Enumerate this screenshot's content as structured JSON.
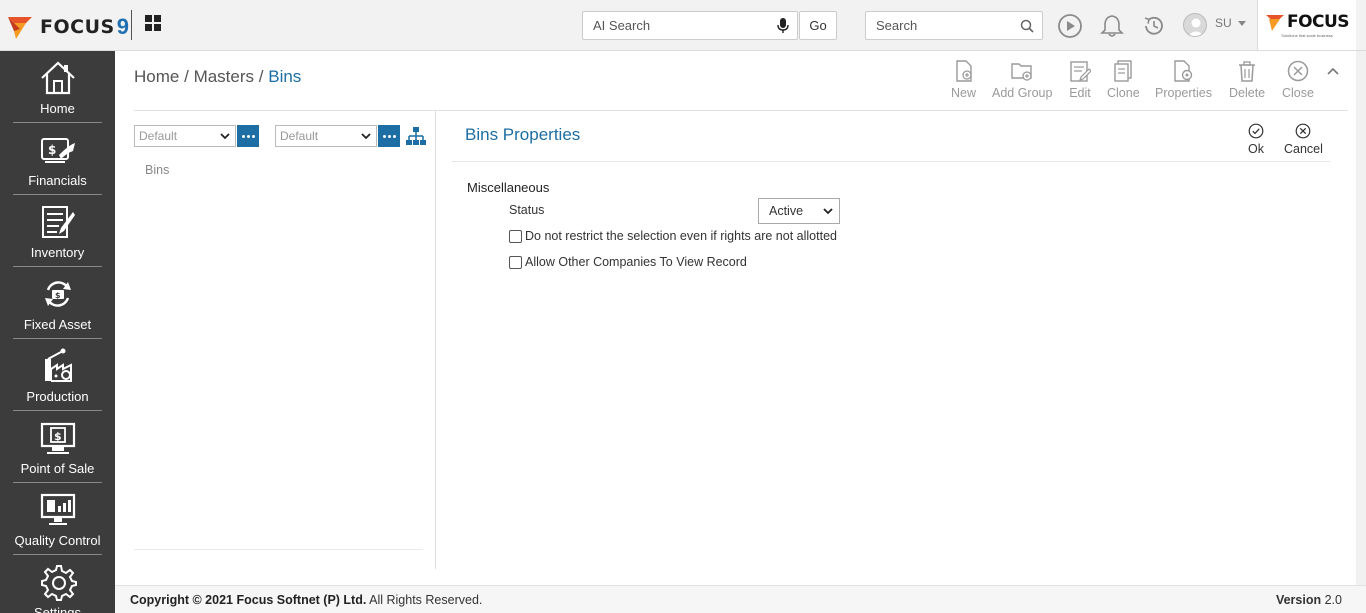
{
  "header": {
    "logo_text": "FOCUS",
    "logo_nine": "9",
    "ai_search_placeholder": "AI Search",
    "go_label": "Go",
    "search_placeholder": "Search",
    "user_initials": "SU",
    "brand_text": "FOCUS",
    "brand_tagline": "Solutions that scale business"
  },
  "sidebar": {
    "items": [
      {
        "label": "Home",
        "icon": "home-icon"
      },
      {
        "label": "Financials",
        "icon": "financials-icon"
      },
      {
        "label": "Inventory",
        "icon": "inventory-icon"
      },
      {
        "label": "Fixed Asset",
        "icon": "fixed-asset-icon"
      },
      {
        "label": "Production",
        "icon": "production-icon"
      },
      {
        "label": "Point of Sale",
        "icon": "point-of-sale-icon"
      },
      {
        "label": "Quality Control",
        "icon": "quality-control-icon"
      },
      {
        "label": "Settings",
        "icon": "settings-icon"
      }
    ]
  },
  "breadcrumb": {
    "home": "Home",
    "sep1": "/",
    "masters": "Masters",
    "sep2": "/",
    "current": "Bins"
  },
  "toolbar": {
    "new": "New",
    "add_group": "Add Group",
    "edit": "Edit",
    "clone": "Clone",
    "properties": "Properties",
    "delete": "Delete",
    "close": "Close"
  },
  "left_panel": {
    "select1_value": "Default",
    "select2_value": "Default",
    "tree_root": "Bins"
  },
  "properties": {
    "title": "Bins Properties",
    "ok_label": "Ok",
    "cancel_label": "Cancel",
    "section": "Miscellaneous",
    "status_label": "Status",
    "status_value": "Active",
    "checkbox1_label": "Do not restrict the selection even if rights are not allotted",
    "checkbox1_checked": false,
    "checkbox2_label": "Allow Other Companies To View Record",
    "checkbox2_checked": false
  },
  "footer": {
    "copyright_prefix": "Copyright © 2021",
    "company": "Focus Softnet (P) Ltd.",
    "rights": "All Rights Reserved.",
    "version_label": "Version",
    "version_value": "2.0"
  },
  "colors": {
    "accent": "#1c6ea4",
    "sidebar_bg": "#3c3c3c",
    "toolbar_gray": "#9a9a9a"
  }
}
